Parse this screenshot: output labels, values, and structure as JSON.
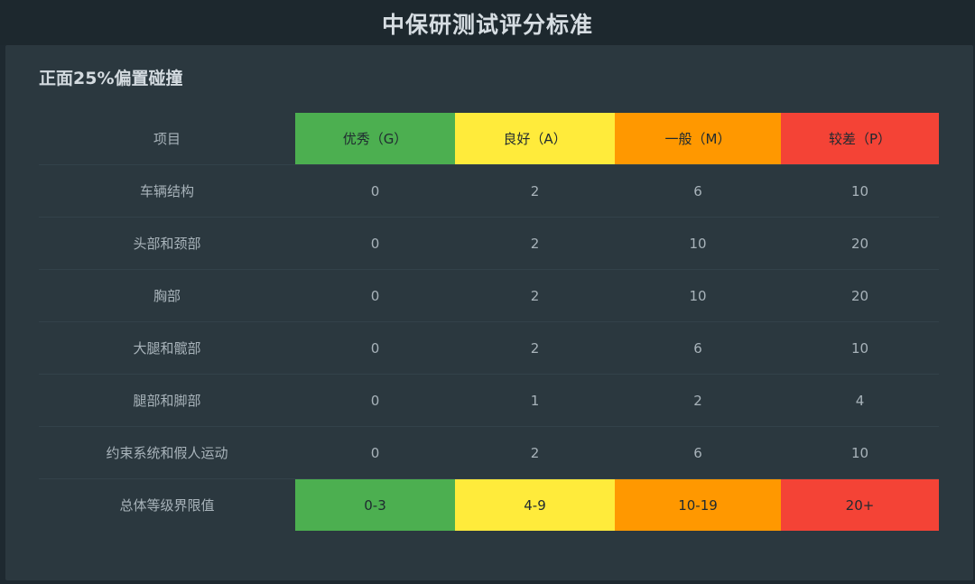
{
  "header": {
    "title": "中保研测试评分标准"
  },
  "section": {
    "title": "正面25%偏置碰撞"
  },
  "table": {
    "corner_label": "项目",
    "columns": [
      {
        "label": "优秀（G）",
        "color": "#4caf50"
      },
      {
        "label": "良好（A）",
        "color": "#ffeb3b"
      },
      {
        "label": "一般（M）",
        "color": "#ff9800"
      },
      {
        "label": "较差（P）",
        "color": "#f44336"
      }
    ],
    "rows": [
      {
        "label": "车辆结构",
        "values": [
          "0",
          "2",
          "6",
          "10"
        ]
      },
      {
        "label": "头部和颈部",
        "values": [
          "0",
          "2",
          "10",
          "20"
        ]
      },
      {
        "label": "胸部",
        "values": [
          "0",
          "2",
          "10",
          "20"
        ]
      },
      {
        "label": "大腿和髋部",
        "values": [
          "0",
          "2",
          "6",
          "10"
        ]
      },
      {
        "label": "腿部和脚部",
        "values": [
          "0",
          "1",
          "2",
          "4"
        ]
      },
      {
        "label": "约束系统和假人运动",
        "values": [
          "0",
          "2",
          "6",
          "10"
        ]
      }
    ],
    "totals": {
      "label": "总体等级界限值",
      "values": [
        "0-3",
        "4-9",
        "10-19",
        "20+"
      ]
    }
  }
}
